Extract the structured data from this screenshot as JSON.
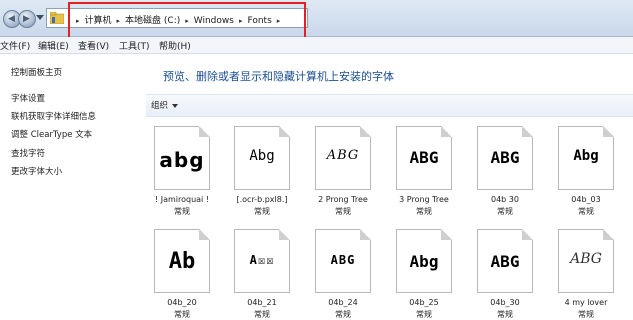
{
  "address": {
    "crumbs": [
      "计算机",
      "本地磁盘 (C:)",
      "Windows",
      "Fonts"
    ],
    "separator": "▸"
  },
  "menu": [
    "文件(F)",
    "编辑(E)",
    "查看(V)",
    "工具(T)",
    "帮助(H)"
  ],
  "sidebar": {
    "items": [
      "控制面板主页",
      "字体设置",
      "联机获取字体详细信息",
      "调整 ClearType 文本",
      "查找字符",
      "更改字体大小"
    ]
  },
  "main": {
    "heading": "预览、删除或者显示和隐藏计算机上安装的字体",
    "organize": "组织"
  },
  "fonts": [
    {
      "sample": "abg",
      "name": "! Jamiroquai !",
      "style": "常规"
    },
    {
      "sample": "Abg",
      "name": "[.ocr-b.pxl8.]",
      "style": "常规"
    },
    {
      "sample": "ABG",
      "name": "2 Prong Tree",
      "style": "常规"
    },
    {
      "sample": "ABG",
      "name": "3 Prong Tree",
      "style": "常规"
    },
    {
      "sample": "ABG",
      "name": "04b 30",
      "style": "常规"
    },
    {
      "sample": "Abg",
      "name": "04b_03",
      "style": "常规"
    },
    {
      "sample": "Ab",
      "name": "04b_20",
      "style": "常规"
    },
    {
      "sample": "A☒☒",
      "name": "04b_21",
      "style": "常规"
    },
    {
      "sample": "ABG",
      "name": "04b_24",
      "style": "常规"
    },
    {
      "sample": "Abg",
      "name": "04b_25",
      "style": "常规"
    },
    {
      "sample": "ABG",
      "name": "04b_30",
      "style": "常规"
    },
    {
      "sample": "ABG",
      "name": "4 my lover",
      "style": "常规"
    }
  ],
  "colors": {
    "highlight_box": "#e52020",
    "heading": "#1b4f8f"
  }
}
